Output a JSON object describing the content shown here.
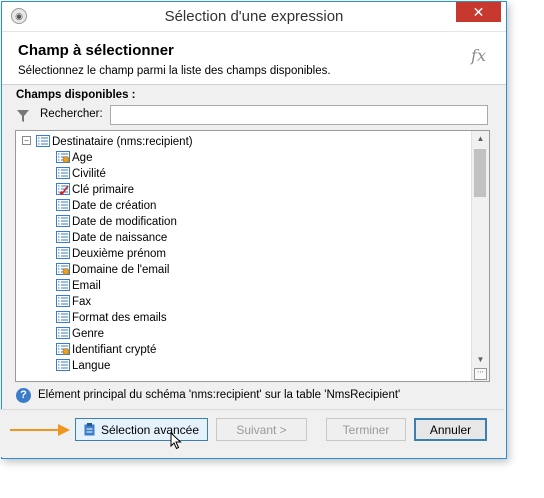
{
  "window": {
    "title": "Sélection d'une expression",
    "close_glyph": "✕"
  },
  "header": {
    "title": "Champ à sélectionner",
    "subtitle": "Sélectionnez le champ parmi la liste des champs disponibles.",
    "fx_icon": "fx"
  },
  "fields": {
    "section_label": "Champs disponibles :",
    "search_label": "Rechercher:",
    "search_value": ""
  },
  "tree": {
    "root": {
      "label": "Destinataire (nms:recipient)",
      "expanded": true
    },
    "items": [
      {
        "label": "Age",
        "icon": "calculated-field-icon"
      },
      {
        "label": "Civilité",
        "icon": "field-icon"
      },
      {
        "label": "Clé primaire",
        "icon": "primary-key-icon"
      },
      {
        "label": "Date de création",
        "icon": "field-icon"
      },
      {
        "label": "Date de modification",
        "icon": "field-icon"
      },
      {
        "label": "Date de naissance",
        "icon": "field-icon"
      },
      {
        "label": "Deuxième prénom",
        "icon": "field-icon"
      },
      {
        "label": "Domaine de l'email",
        "icon": "calculated-field-icon"
      },
      {
        "label": "Email",
        "icon": "field-icon"
      },
      {
        "label": "Fax",
        "icon": "field-icon"
      },
      {
        "label": "Format des emails",
        "icon": "field-icon"
      },
      {
        "label": "Genre",
        "icon": "field-icon"
      },
      {
        "label": "Identifiant crypté",
        "icon": "calculated-field-icon"
      },
      {
        "label": "Langue",
        "icon": "field-icon"
      }
    ]
  },
  "info": {
    "text": "Elément principal du schéma 'nms:recipient' sur la table 'NmsRecipient'"
  },
  "buttons": {
    "advanced": "Sélection avancée",
    "next": "Suivant >",
    "finish": "Terminer",
    "cancel": "Annuler"
  },
  "colors": {
    "accent": "#2b8fd4",
    "close": "#c7392f",
    "annotation_arrow": "#f0961f",
    "icon_blue": "#3b7dc9",
    "key_red": "#cc2b2b",
    "calc_orange": "#e8a020"
  }
}
